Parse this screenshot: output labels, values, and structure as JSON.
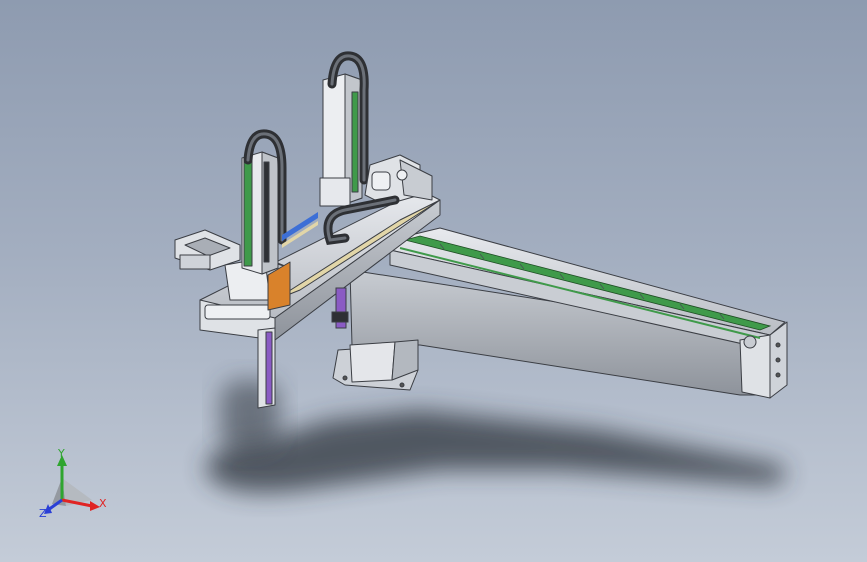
{
  "viewport": {
    "background_top": "#8e9bb0",
    "background_bottom": "#c4ccd8"
  },
  "model": {
    "name_icon": "gantry-robot-3d-model",
    "colors": {
      "frame": "#d6d9de",
      "frame_dark": "#9fa4ab",
      "frame_line": "#3b3e44",
      "rail_green": "#3f9a4a",
      "accent_orange": "#d9822b",
      "accent_purple": "#8a5bc4",
      "accent_blue": "#3d6fd6",
      "cable_chain": "#2e3034",
      "shadow": "#3a3f48"
    }
  },
  "triad": {
    "x_label": "X",
    "y_label": "Y",
    "z_label": "Z",
    "x_color": "#e02424",
    "y_color": "#2fa52f",
    "z_color": "#2a3fd6"
  }
}
